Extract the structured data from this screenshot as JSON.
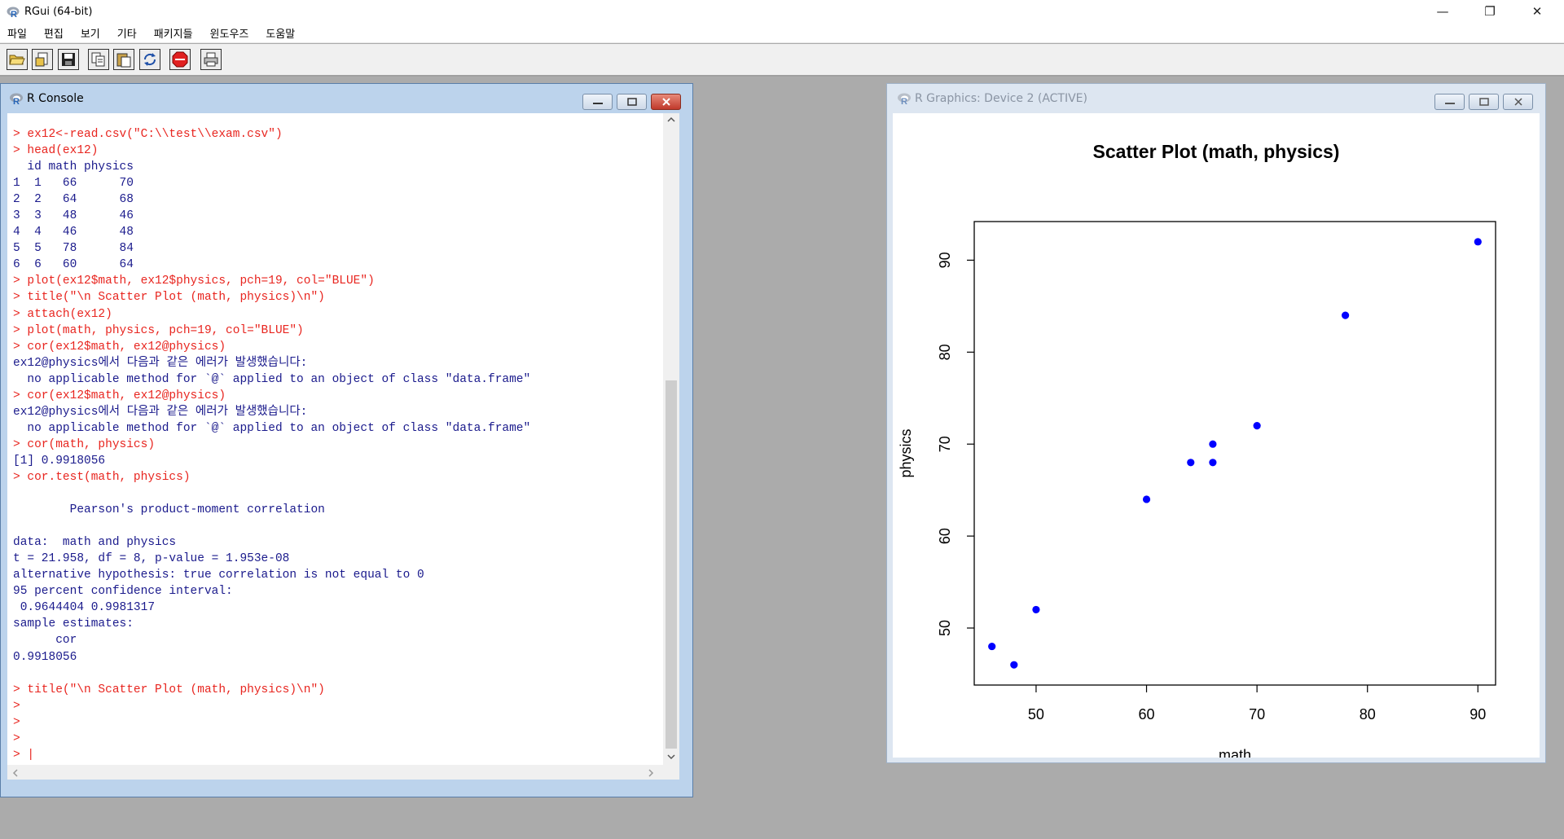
{
  "app": {
    "title": "RGui (64-bit)",
    "menu": [
      "파일",
      "편집",
      "보기",
      "기타",
      "패키지들",
      "윈도우즈",
      "도움말"
    ],
    "window_controls": {
      "minimize": "—",
      "restore": "❐",
      "close": "✕"
    }
  },
  "toolbar": {
    "buttons": [
      "open-script",
      "load-workspace",
      "save-workspace",
      "copy",
      "paste",
      "copy-paste",
      "stop",
      "print"
    ]
  },
  "console": {
    "title": "R Console",
    "lines": [
      {
        "t": "> ex12<-read.csv(\"C:\\\\test\\\\exam.csv\")",
        "k": "in"
      },
      {
        "t": "> head(ex12)",
        "k": "in"
      },
      {
        "t": "  id math physics",
        "k": "out"
      },
      {
        "t": "1  1   66      70",
        "k": "out"
      },
      {
        "t": "2  2   64      68",
        "k": "out"
      },
      {
        "t": "3  3   48      46",
        "k": "out"
      },
      {
        "t": "4  4   46      48",
        "k": "out"
      },
      {
        "t": "5  5   78      84",
        "k": "out"
      },
      {
        "t": "6  6   60      64",
        "k": "out"
      },
      {
        "t": "> plot(ex12$math, ex12$physics, pch=19, col=\"BLUE\")",
        "k": "in"
      },
      {
        "t": "> title(\"\\n Scatter Plot (math, physics)\\n\")",
        "k": "in"
      },
      {
        "t": "> attach(ex12)",
        "k": "in"
      },
      {
        "t": "> plot(math, physics, pch=19, col=\"BLUE\")",
        "k": "in"
      },
      {
        "t": "> cor(ex12$math, ex12@physics)",
        "k": "in"
      },
      {
        "t": "ex12@physics에서 다음과 같은 에러가 발생했습니다:",
        "k": "out"
      },
      {
        "t": "  no applicable method for `@` applied to an object of class \"data.frame\"",
        "k": "out"
      },
      {
        "t": "> cor(ex12$math, ex12@physics)",
        "k": "in"
      },
      {
        "t": "ex12@physics에서 다음과 같은 에러가 발생했습니다:",
        "k": "out"
      },
      {
        "t": "  no applicable method for `@` applied to an object of class \"data.frame\"",
        "k": "out"
      },
      {
        "t": "> cor(math, physics)",
        "k": "in"
      },
      {
        "t": "[1] 0.9918056",
        "k": "out"
      },
      {
        "t": "> cor.test(math, physics)",
        "k": "in"
      },
      {
        "t": "",
        "k": "out"
      },
      {
        "t": "        Pearson's product-moment correlation",
        "k": "out"
      },
      {
        "t": "",
        "k": "out"
      },
      {
        "t": "data:  math and physics",
        "k": "out"
      },
      {
        "t": "t = 21.958, df = 8, p-value = 1.953e-08",
        "k": "out"
      },
      {
        "t": "alternative hypothesis: true correlation is not equal to 0",
        "k": "out"
      },
      {
        "t": "95 percent confidence interval:",
        "k": "out"
      },
      {
        "t": " 0.9644404 0.9981317",
        "k": "out"
      },
      {
        "t": "sample estimates:",
        "k": "out"
      },
      {
        "t": "      cor",
        "k": "out"
      },
      {
        "t": "0.9918056",
        "k": "out"
      },
      {
        "t": "",
        "k": "out"
      },
      {
        "t": "> title(\"\\n Scatter Plot (math, physics)\\n\")",
        "k": "in"
      },
      {
        "t": ">",
        "k": "in"
      },
      {
        "t": ">",
        "k": "in"
      },
      {
        "t": ">",
        "k": "in"
      },
      {
        "t": "> |",
        "k": "in"
      }
    ]
  },
  "graphics": {
    "title": "R Graphics: Device 2 (ACTIVE)"
  },
  "chart_data": {
    "type": "scatter",
    "title": "Scatter Plot (math, physics)",
    "xlabel": "math",
    "ylabel": "physics",
    "x": [
      66,
      64,
      48,
      46,
      78,
      60,
      90,
      50,
      66,
      70
    ],
    "y": [
      70,
      68,
      46,
      48,
      84,
      64,
      92,
      52,
      68,
      72
    ],
    "xlim": [
      44.4,
      91.6
    ],
    "ylim": [
      43.8,
      94.2
    ],
    "xticks": [
      50,
      60,
      70,
      80,
      90
    ],
    "yticks": [
      50,
      60,
      70,
      80,
      90
    ],
    "point_color": "#0000ff",
    "grid": false
  },
  "colors": {
    "console_input": "#e8251f",
    "console_output": "#1a1a8c",
    "stop_button": "#e02020"
  }
}
